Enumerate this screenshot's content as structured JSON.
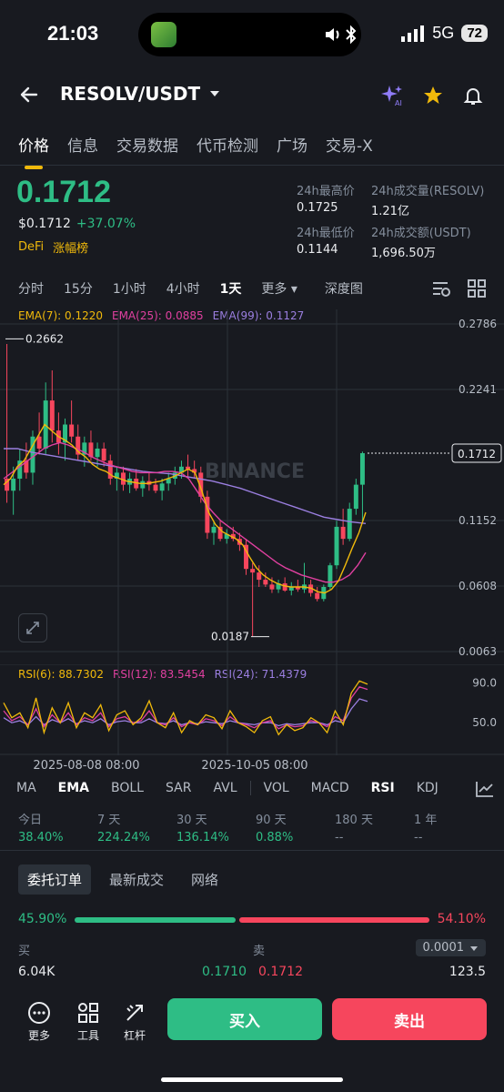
{
  "status_bar": {
    "time": "21:03",
    "network": "5G",
    "battery": "72"
  },
  "header": {
    "pair": "RESOLV/USDT",
    "icons": [
      "back-arrow-icon",
      "caret-down-icon",
      "ai-sparkle-icon",
      "star-icon",
      "bell-icon"
    ]
  },
  "tabs": [
    {
      "label": "价格",
      "active": true
    },
    {
      "label": "信息"
    },
    {
      "label": "交易数据"
    },
    {
      "label": "代币检测"
    },
    {
      "label": "广场"
    },
    {
      "label": "交易-X"
    }
  ],
  "price": {
    "last": "0.1712",
    "usd": "$0.1712",
    "change": "+37.07%",
    "tag1": "DeFi",
    "tag2": "涨幅榜"
  },
  "stats": {
    "high_label": "24h最高价",
    "high": "0.1725",
    "vol_base_label": "24h成交量(RESOLV)",
    "vol_base": "1.21亿",
    "low_label": "24h最低价",
    "low": "0.1144",
    "vol_quote_label": "24h成交额(USDT)",
    "vol_quote": "1,696.50万"
  },
  "intervals": [
    "分时",
    "15分",
    "1小时",
    "4小时",
    "1天",
    "更多",
    "深度图"
  ],
  "active_interval": "1天",
  "ema_legend": {
    "ema7": "EMA(7): 0.1220",
    "ema25": "EMA(25): 0.0885",
    "ema99": "EMA(99): 0.1127"
  },
  "colors": {
    "green": "#2ebd85",
    "red": "#f6465d",
    "ema7": "#f0b90b",
    "ema25": "#e040a0",
    "ema99": "#9b7fe0",
    "accent": "#f0b90b"
  },
  "chart_data": {
    "type": "candlestick",
    "watermark": "BINANCE",
    "y_ticks": [
      "0.2786",
      "0.2241",
      "0.1712",
      "0.1152",
      "0.0608",
      "0.0063"
    ],
    "ylim": [
      0.0063,
      0.2786
    ],
    "current_price_label": "0.1712",
    "max_label": "0.2662",
    "min_label": "0.0187",
    "x_labels": [
      "2025-08-08 08:00",
      "2025-10-05 08:00"
    ],
    "candles": [
      [
        0.15,
        0.262,
        0.13,
        0.14
      ],
      [
        0.14,
        0.16,
        0.12,
        0.15
      ],
      [
        0.15,
        0.175,
        0.14,
        0.165
      ],
      [
        0.165,
        0.18,
        0.15,
        0.155
      ],
      [
        0.155,
        0.19,
        0.145,
        0.185
      ],
      [
        0.185,
        0.205,
        0.17,
        0.175
      ],
      [
        0.175,
        0.23,
        0.17,
        0.215
      ],
      [
        0.215,
        0.24,
        0.18,
        0.19
      ],
      [
        0.19,
        0.205,
        0.17,
        0.18
      ],
      [
        0.18,
        0.2,
        0.165,
        0.195
      ],
      [
        0.195,
        0.215,
        0.18,
        0.185
      ],
      [
        0.185,
        0.195,
        0.165,
        0.17
      ],
      [
        0.17,
        0.185,
        0.16,
        0.18
      ],
      [
        0.18,
        0.19,
        0.165,
        0.168
      ],
      [
        0.168,
        0.18,
        0.16,
        0.175
      ],
      [
        0.175,
        0.18,
        0.16,
        0.165
      ],
      [
        0.165,
        0.17,
        0.145,
        0.15
      ],
      [
        0.15,
        0.16,
        0.14,
        0.155
      ],
      [
        0.155,
        0.16,
        0.14,
        0.145
      ],
      [
        0.145,
        0.155,
        0.138,
        0.15
      ],
      [
        0.15,
        0.158,
        0.14,
        0.142
      ],
      [
        0.142,
        0.152,
        0.135,
        0.148
      ],
      [
        0.148,
        0.155,
        0.14,
        0.145
      ],
      [
        0.145,
        0.15,
        0.138,
        0.14
      ],
      [
        0.14,
        0.15,
        0.132,
        0.146
      ],
      [
        0.146,
        0.155,
        0.14,
        0.15
      ],
      [
        0.15,
        0.16,
        0.145,
        0.155
      ],
      [
        0.155,
        0.165,
        0.15,
        0.16
      ],
      [
        0.16,
        0.17,
        0.152,
        0.158
      ],
      [
        0.158,
        0.165,
        0.15,
        0.155
      ],
      [
        0.155,
        0.16,
        0.13,
        0.135
      ],
      [
        0.135,
        0.14,
        0.1,
        0.105
      ],
      [
        0.105,
        0.115,
        0.095,
        0.11
      ],
      [
        0.11,
        0.115,
        0.098,
        0.1
      ],
      [
        0.1,
        0.108,
        0.096,
        0.104
      ],
      [
        0.104,
        0.11,
        0.098,
        0.1
      ],
      [
        0.1,
        0.105,
        0.09,
        0.095
      ],
      [
        0.095,
        0.1,
        0.07,
        0.075
      ],
      [
        0.075,
        0.08,
        0.019,
        0.072
      ],
      [
        0.072,
        0.078,
        0.06,
        0.066
      ],
      [
        0.066,
        0.072,
        0.06,
        0.062
      ],
      [
        0.062,
        0.068,
        0.055,
        0.058
      ],
      [
        0.058,
        0.066,
        0.055,
        0.063
      ],
      [
        0.063,
        0.068,
        0.056,
        0.057
      ],
      [
        0.057,
        0.064,
        0.053,
        0.06
      ],
      [
        0.06,
        0.066,
        0.056,
        0.058
      ],
      [
        0.058,
        0.08,
        0.055,
        0.062
      ],
      [
        0.062,
        0.066,
        0.052,
        0.055
      ],
      [
        0.055,
        0.06,
        0.048,
        0.05
      ],
      [
        0.05,
        0.062,
        0.048,
        0.06
      ],
      [
        0.06,
        0.08,
        0.058,
        0.078
      ],
      [
        0.078,
        0.115,
        0.075,
        0.11
      ],
      [
        0.11,
        0.125,
        0.095,
        0.1
      ],
      [
        0.1,
        0.13,
        0.098,
        0.125
      ],
      [
        0.125,
        0.15,
        0.12,
        0.145
      ],
      [
        0.145,
        0.1725,
        0.1144,
        0.1712
      ]
    ],
    "ema_series": {
      "ema7": [
        0.145,
        0.15,
        0.16,
        0.165,
        0.175,
        0.185,
        0.195,
        0.19,
        0.185,
        0.182,
        0.178,
        0.172,
        0.168,
        0.162,
        0.158,
        0.156,
        0.152,
        0.15,
        0.148,
        0.147,
        0.146,
        0.146,
        0.147,
        0.148,
        0.15,
        0.152,
        0.155,
        0.158,
        0.155,
        0.14,
        0.122,
        0.112,
        0.106,
        0.103,
        0.1,
        0.095,
        0.085,
        0.076,
        0.07,
        0.066,
        0.063,
        0.061,
        0.06,
        0.06,
        0.06,
        0.059,
        0.056,
        0.055,
        0.058,
        0.065,
        0.078,
        0.092,
        0.105,
        0.122
      ],
      "ema25": [
        0.15,
        0.155,
        0.16,
        0.165,
        0.17,
        0.175,
        0.178,
        0.18,
        0.178,
        0.175,
        0.172,
        0.168,
        0.165,
        0.162,
        0.16,
        0.158,
        0.156,
        0.155,
        0.155,
        0.155,
        0.156,
        0.156,
        0.155,
        0.15,
        0.14,
        0.13,
        0.122,
        0.115,
        0.11,
        0.105,
        0.1,
        0.095,
        0.09,
        0.085,
        0.08,
        0.076,
        0.073,
        0.07,
        0.068,
        0.066,
        0.064,
        0.064,
        0.066,
        0.07,
        0.078,
        0.0885
      ],
      "ema99": [
        0.175,
        0.175,
        0.172,
        0.17,
        0.168,
        0.166,
        0.164,
        0.162,
        0.16,
        0.158,
        0.156,
        0.155,
        0.154,
        0.152,
        0.15,
        0.148,
        0.145,
        0.142,
        0.138,
        0.134,
        0.13,
        0.126,
        0.122,
        0.118,
        0.116,
        0.114,
        0.1127
      ]
    },
    "rsi_legend": {
      "rsi6": "RSI(6): 88.7302",
      "rsi12": "RSI(12): 83.5454",
      "rsi24": "RSI(24): 71.4379"
    },
    "rsi_ticks": [
      "90.0",
      "50.0"
    ],
    "rsi_series": {
      "rsi6": [
        70,
        55,
        60,
        45,
        75,
        40,
        65,
        50,
        70,
        45,
        60,
        55,
        68,
        42,
        58,
        62,
        48,
        55,
        72,
        50,
        45,
        60,
        40,
        52,
        48,
        58,
        55,
        44,
        62,
        50,
        46,
        40,
        52,
        56,
        38,
        48,
        42,
        45,
        55,
        50,
        40,
        62,
        48,
        80,
        92,
        88.7
      ],
      "rsi12": [
        62,
        52,
        56,
        48,
        64,
        46,
        58,
        50,
        60,
        48,
        55,
        52,
        60,
        46,
        54,
        56,
        50,
        52,
        62,
        50,
        48,
        55,
        46,
        50,
        48,
        54,
        52,
        47,
        56,
        50,
        48,
        45,
        50,
        52,
        44,
        48,
        46,
        47,
        52,
        50,
        46,
        56,
        52,
        75,
        86,
        83.5
      ],
      "rsi24": [
        55,
        50,
        52,
        48,
        56,
        48,
        53,
        50,
        54,
        49,
        52,
        50,
        54,
        48,
        51,
        52,
        50,
        50,
        54,
        50,
        49,
        52,
        48,
        50,
        49,
        51,
        50,
        49,
        52,
        50,
        49,
        48,
        50,
        50,
        47,
        49,
        48,
        49,
        50,
        50,
        48,
        52,
        50,
        64,
        74,
        71.4
      ]
    }
  },
  "indicators": [
    "MA",
    "EMA",
    "BOLL",
    "SAR",
    "AVL",
    "VOL",
    "MACD",
    "RSI",
    "KDJ"
  ],
  "active_indicators": [
    "EMA",
    "RSI"
  ],
  "performance": [
    {
      "label": "今日",
      "value": "38.40%"
    },
    {
      "label": "7 天",
      "value": "224.24%"
    },
    {
      "label": "30 天",
      "value": "136.14%"
    },
    {
      "label": "90 天",
      "value": "0.88%"
    },
    {
      "label": "180 天",
      "value": "--"
    },
    {
      "label": "1 年",
      "value": "--"
    }
  ],
  "orderbook": {
    "tabs": [
      "委托订单",
      "最新成交",
      "网络"
    ],
    "buy_ratio": "45.90%",
    "sell_ratio": "54.10%",
    "buy_label": "买",
    "sell_label": "卖",
    "precision": "0.0001",
    "buy_qty": "6.04K",
    "buy_price": "0.1710",
    "sell_price": "0.1712",
    "sell_qty": "123.5"
  },
  "bottom": {
    "more": "更多",
    "tools": "工具",
    "leverage": "杠杆",
    "buy": "买入",
    "sell": "卖出"
  }
}
